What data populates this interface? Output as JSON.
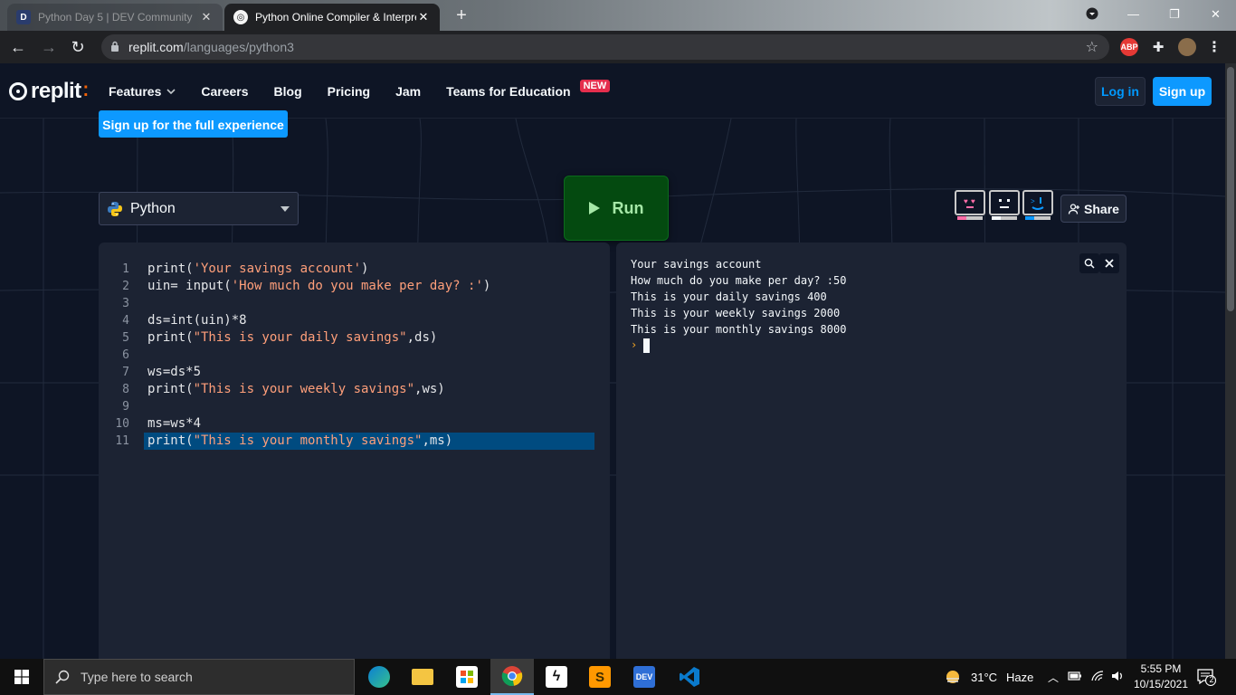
{
  "browser": {
    "tabs": [
      {
        "favicon": "D",
        "label": "Python Day 5 | DEV Community",
        "active": false
      },
      {
        "favicon": "replit-icon",
        "label": "Python Online Compiler & Interpreter",
        "active": true
      }
    ],
    "url_host": "replit.com",
    "url_path": "/languages/python3"
  },
  "header": {
    "logo_text": "replit",
    "nav": [
      {
        "label": "Features",
        "has_dropdown": true
      },
      {
        "label": "Careers"
      },
      {
        "label": "Blog"
      },
      {
        "label": "Pricing"
      },
      {
        "label": "Jam"
      },
      {
        "label": "Teams for Education",
        "badge": "NEW"
      }
    ],
    "login_label": "Log in",
    "signup_label": "Sign up"
  },
  "page": {
    "signup_full_label": "Sign up for the full experience",
    "language": "Python",
    "run_label": "Run",
    "share_label": "Share"
  },
  "editor": {
    "lines": [
      "print('Your savings account')",
      "uin= input('How much do you make per day? :')",
      "",
      "ds=int(uin)*8",
      "print(\"This is your daily savings\",ds)",
      "",
      "ws=ds*5",
      "print(\"This is your weekly savings\",ws)",
      "",
      "ms=ws*4",
      "print(\"This is your monthly savings\",ms)"
    ],
    "selected_line": 11
  },
  "console": {
    "output": [
      "Your savings account",
      "How much do you make per day? :50",
      "This is your daily savings 400",
      "This is your weekly savings 2000",
      "This is your monthly savings 8000"
    ],
    "prompt": "›"
  },
  "taskbar": {
    "search_placeholder": "Type here to search",
    "weather_temp": "31°C",
    "weather_desc": "Haze",
    "time": "5:55 PM",
    "date": "10/15/2021",
    "notification_count": "2"
  },
  "colors": {
    "page_bg": "#0e1525",
    "panel_bg": "#1c2333",
    "accent_blue": "#0d99ff",
    "run_green": "#044a10",
    "badge_red": "#e52e4d",
    "string_color": "#ff9f7a"
  }
}
